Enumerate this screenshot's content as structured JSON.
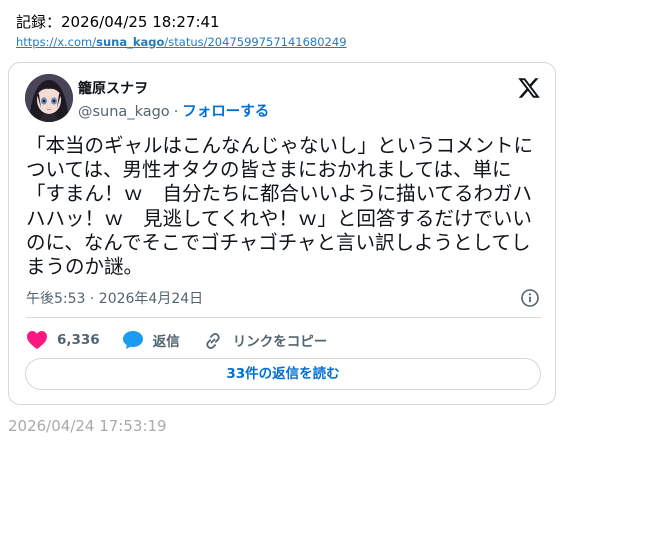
{
  "header": {
    "record_label": "記録：2026/04/25 18:27:41",
    "link_prefix": "https://x.com/",
    "link_user": "suna_kago",
    "link_suffix": "/status/2047599757141680249"
  },
  "tweet": {
    "display_name": "籠原スナヲ",
    "handle": "@suna_kago",
    "separator": "·",
    "follow_label": "フォローする",
    "text": "「本当のギャルはこんなんじゃないし」というコメントについては、男性オタクの皆さまにおかれましては、単に「すまん！ｗ　自分たちに都合いいように描いてるわガハハハッ！ｗ　見逃してくれや！ｗ」と回答するだけでいいのに、なんでそこでゴチャゴチャと言い訳しようとしてしまうのか謎。",
    "timestamp": "午後5:53 · 2026年4月24日",
    "like_count": "6,336",
    "reply_label": "返信",
    "copy_link_label": "リンクをコピー",
    "read_replies_label": "33件の返信を読む"
  },
  "footer": {
    "saved_at": "2026/04/24 17:53:19"
  },
  "colors": {
    "like": "#f91880",
    "reply": "#1d9bf0",
    "link": "#006fd6",
    "muted": "#536471",
    "border": "#cfd9de"
  },
  "icons": {
    "logo": "x-logo-icon",
    "info": "info-icon",
    "like": "heart-icon",
    "reply": "speech-bubble-icon",
    "copy_link": "link-icon"
  }
}
